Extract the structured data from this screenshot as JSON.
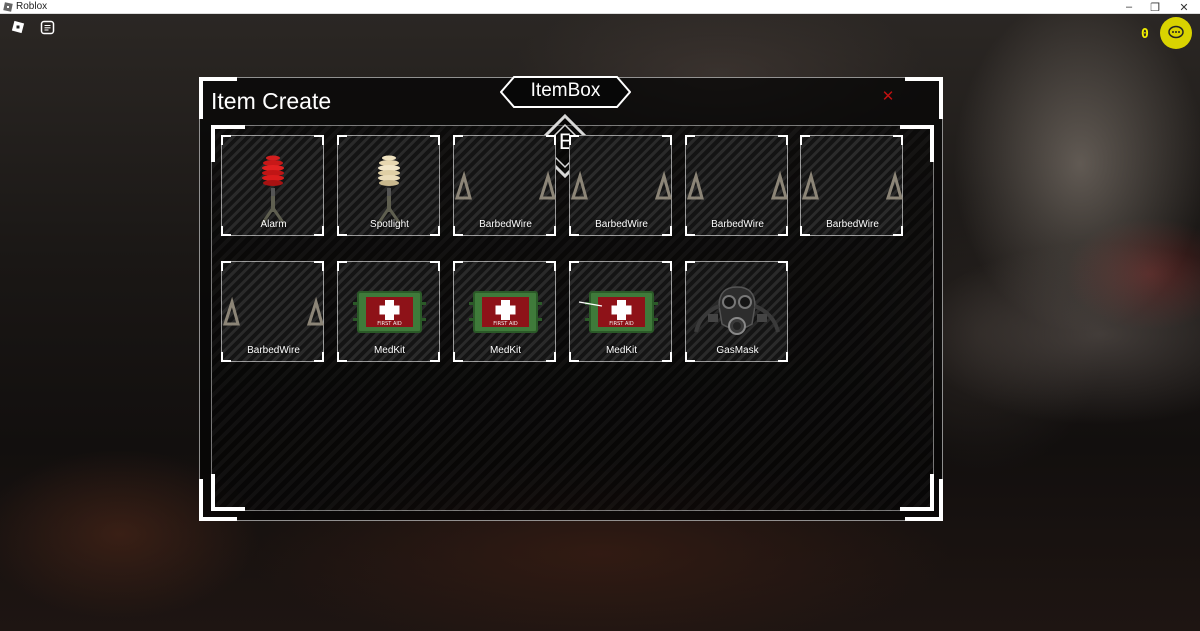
{
  "window": {
    "title": "Roblox",
    "minimize_icon": "minimize-icon",
    "maximize_icon": "restore-icon",
    "close_icon": "close-icon"
  },
  "hud": {
    "roblox_menu_icon": "roblox-logo-icon",
    "chat_toggle_icon": "chat-icon",
    "coin_count": "0",
    "chat_bubble_icon": "chat-bubble-icon"
  },
  "panel": {
    "title": "Item Create",
    "tab_label": "ItemBox",
    "key_hint": "E",
    "close_icon": "close-icon"
  },
  "items": [
    {
      "label": "Alarm",
      "icon": "alarm-icon"
    },
    {
      "label": "Spotlight",
      "icon": "spotlight-icon"
    },
    {
      "label": "BarbedWire",
      "icon": "barbed-wire-icon"
    },
    {
      "label": "BarbedWire",
      "icon": "barbed-wire-icon"
    },
    {
      "label": "BarbedWire",
      "icon": "barbed-wire-icon"
    },
    {
      "label": "BarbedWire",
      "icon": "barbed-wire-icon"
    },
    {
      "label": "BarbedWire",
      "icon": "barbed-wire-icon"
    },
    {
      "label": "MedKit",
      "icon": "medkit-icon",
      "badge": "FIRST AID"
    },
    {
      "label": "MedKit",
      "icon": "medkit-icon",
      "badge": "FIRST AID"
    },
    {
      "label": "MedKit",
      "icon": "medkit-icon",
      "badge": "FIRST AID"
    },
    {
      "label": "GasMask",
      "icon": "gas-mask-icon"
    }
  ],
  "colors": {
    "accent_yellow": "#d9d300",
    "close_red": "#c01010",
    "medkit_green": "#3f7a3a",
    "medkit_red": "#8e1218"
  }
}
